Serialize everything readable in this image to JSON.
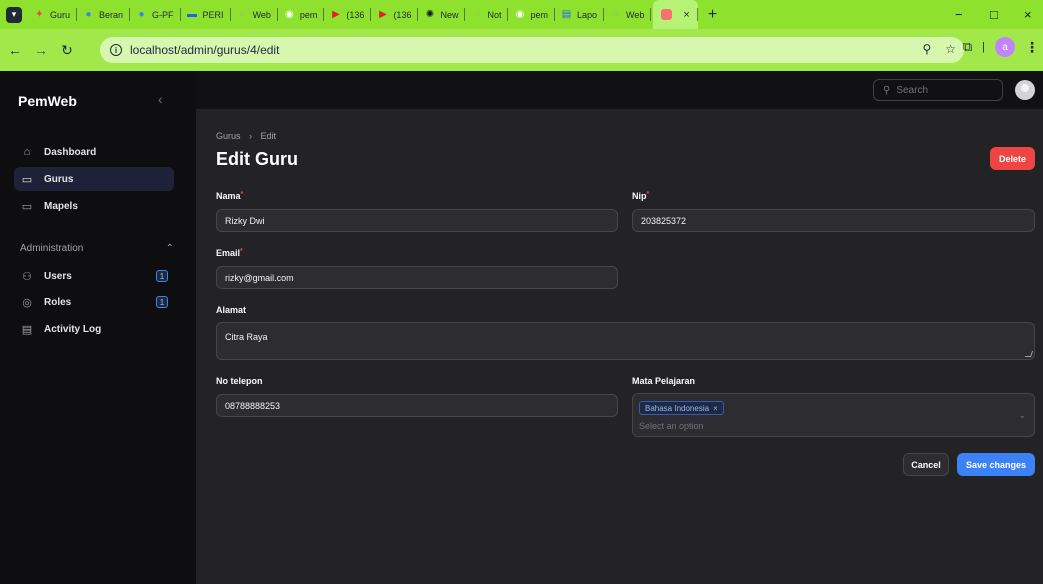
{
  "browser": {
    "tabs": [
      {
        "title": "Guru",
        "icon": "laravel-icon",
        "color": "#ef4444"
      },
      {
        "title": "Beran",
        "icon": "chrome-icon",
        "color": "#3b82f6"
      },
      {
        "title": "G-PF",
        "icon": "chrome-icon",
        "color": "#3b82f6"
      },
      {
        "title": "PERI",
        "icon": "monitor-icon",
        "color": "#2563eb"
      },
      {
        "title": "Web",
        "icon": "globe-icon",
        "color": "#9ca3af"
      },
      {
        "title": "pem",
        "icon": "github-icon",
        "color": "#ffffff"
      },
      {
        "title": "(136",
        "icon": "youtube-icon",
        "color": "#dc2626"
      },
      {
        "title": "(136",
        "icon": "youtube-icon",
        "color": "#dc2626"
      },
      {
        "title": "New",
        "icon": "openai-icon",
        "color": "#111827"
      },
      {
        "title": "Not",
        "icon": "globe-icon",
        "color": "#9ca3af"
      },
      {
        "title": "pem",
        "icon": "github-icon",
        "color": "#ffffff"
      },
      {
        "title": "Lapo",
        "icon": "docs-icon",
        "color": "#2563eb"
      },
      {
        "title": "Web",
        "icon": "globe-icon",
        "color": "#9ca3af"
      }
    ],
    "active_tab_close": "×",
    "new_tab": "+",
    "url": "localhost/admin/gurus/4/edit",
    "profile_initial": "a",
    "window_controls": {
      "minimize": "−",
      "restore": "□",
      "close": "×"
    }
  },
  "sidebar": {
    "brand": "PemWeb",
    "items": [
      {
        "label": "Dashboard",
        "icon": "home-icon",
        "active": false
      },
      {
        "label": "Gurus",
        "icon": "folder-icon",
        "active": true
      },
      {
        "label": "Mapels",
        "icon": "folder-icon",
        "active": false
      }
    ],
    "group": {
      "label": "Administration",
      "items": [
        {
          "label": "Users",
          "icon": "users-icon",
          "badge": "1"
        },
        {
          "label": "Roles",
          "icon": "shield-check-icon",
          "badge": "1"
        },
        {
          "label": "Activity Log",
          "icon": "clipboard-icon",
          "badge": ""
        }
      ]
    }
  },
  "topbar": {
    "search_placeholder": "Search"
  },
  "page": {
    "breadcrumb": [
      "Gurus",
      "Edit"
    ],
    "title": "Edit Guru",
    "delete_label": "Delete"
  },
  "form": {
    "nama": {
      "label": "Nama",
      "required": "*",
      "value": "Rizky Dwi"
    },
    "nip": {
      "label": "Nip",
      "required": "*",
      "value": "203825372"
    },
    "email": {
      "label": "Email",
      "required": "*",
      "value": "rizky@gmail.com"
    },
    "alamat": {
      "label": "Alamat",
      "value": "Citra Raya"
    },
    "telepon": {
      "label": "No telepon",
      "value": "08788888253"
    },
    "mapel": {
      "label": "Mata Pelajaran",
      "selected": "Bahasa Indonesia",
      "placeholder": "Select an option"
    }
  },
  "actions": {
    "cancel": "Cancel",
    "save": "Save changes"
  },
  "colors": {
    "accent": "#3b82f6",
    "danger": "#ef4444",
    "browser_frame": "#8ee12c"
  }
}
